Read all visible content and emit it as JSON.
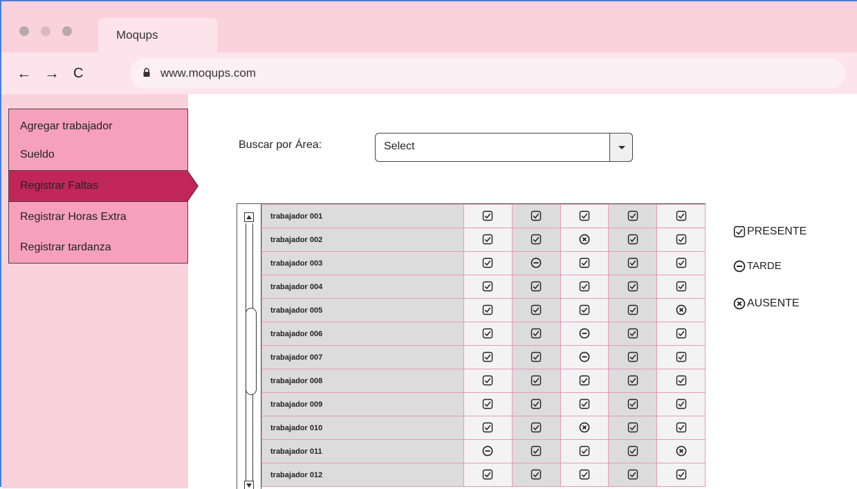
{
  "browser": {
    "tab_title": "Moqups",
    "url": "www.moqups.com",
    "nav": {
      "back": "←",
      "forward": "→",
      "reload": "C"
    }
  },
  "sidebar": {
    "items": [
      {
        "label": "Agregar trabajador"
      },
      {
        "label": "Sueldo"
      },
      {
        "label": "Registrar Faltas",
        "active": true
      },
      {
        "label": "Registrar Horas Extra"
      },
      {
        "label": "Registrar tardanza"
      }
    ]
  },
  "search": {
    "label": "Buscar por Área:",
    "selected": "Select"
  },
  "attendance": {
    "rows": [
      {
        "name": "trabajador 001",
        "marks": [
          "P",
          "P",
          "P",
          "P",
          "P"
        ]
      },
      {
        "name": "trabajador 002",
        "marks": [
          "P",
          "P",
          "A",
          "P",
          "P"
        ]
      },
      {
        "name": "trabajador 003",
        "marks": [
          "P",
          "T",
          "P",
          "P",
          "P"
        ]
      },
      {
        "name": "trabajador 004",
        "marks": [
          "P",
          "P",
          "P",
          "P",
          "P"
        ]
      },
      {
        "name": "trabajador 005",
        "marks": [
          "P",
          "P",
          "P",
          "P",
          "A"
        ]
      },
      {
        "name": "trabajador 006",
        "marks": [
          "P",
          "P",
          "T",
          "P",
          "P"
        ]
      },
      {
        "name": "trabajador 007",
        "marks": [
          "P",
          "P",
          "T",
          "P",
          "P"
        ]
      },
      {
        "name": "trabajador 008",
        "marks": [
          "P",
          "P",
          "P",
          "P",
          "P"
        ]
      },
      {
        "name": "trabajador 009",
        "marks": [
          "P",
          "P",
          "P",
          "P",
          "P"
        ]
      },
      {
        "name": "trabajador 010",
        "marks": [
          "P",
          "P",
          "A",
          "P",
          "P"
        ]
      },
      {
        "name": "trabajador 011",
        "marks": [
          "T",
          "P",
          "P",
          "P",
          "A"
        ]
      },
      {
        "name": "trabajador 012",
        "marks": [
          "P",
          "P",
          "P",
          "P",
          "P"
        ]
      }
    ]
  },
  "legend": {
    "present": "PRESENTE",
    "late": "TARDE",
    "absent": "AUSENTE"
  },
  "colors": {
    "chrome": "#fad2de",
    "menu_item": "#f6a0bd",
    "menu_active": "#c0265a",
    "grid_line": "#e59ab7"
  }
}
